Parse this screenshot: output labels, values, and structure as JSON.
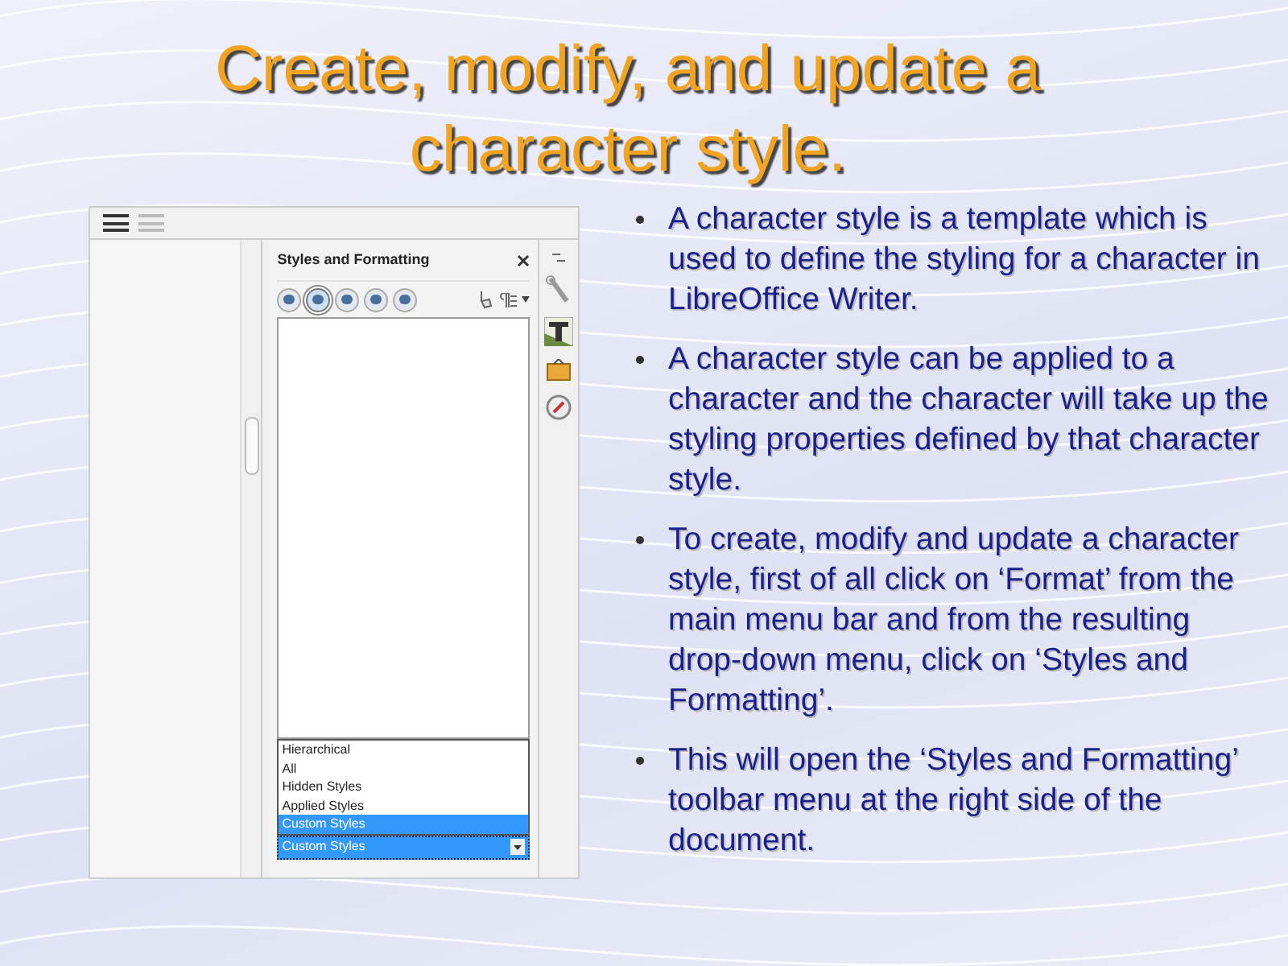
{
  "title": "Create, modify, and update a character style.",
  "screenshot": {
    "panel": {
      "title": "Styles and Formatting",
      "filter_options": [
        {
          "label": "Hierarchical",
          "selected": false
        },
        {
          "label": "All",
          "selected": false
        },
        {
          "label": "Hidden Styles",
          "selected": false
        },
        {
          "label": "Applied Styles",
          "selected": false
        },
        {
          "label": "Custom Styles",
          "selected": true
        }
      ],
      "filter_value": "Custom Styles"
    }
  },
  "bullets": [
    "A character style is a template which is used to define the styling for a character in LibreOffice Writer.",
    "A character style can be applied to a character and the character will take up the styling properties defined by that character style.",
    "To create, modify and update a character style, first of all click on ‘Format’ from the main menu bar and from the resulting drop-down menu, click on ‘Styles and Formatting’.",
    "This will open the ‘Styles and Formatting’ toolbar menu at the right side of the document."
  ]
}
